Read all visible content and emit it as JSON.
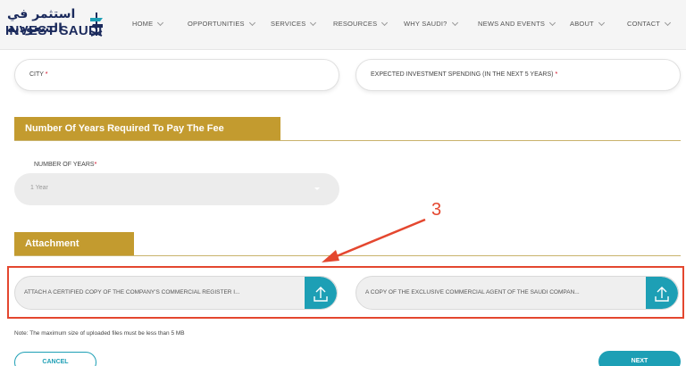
{
  "header": {
    "logo_arabic": "استثمر في السعودية",
    "logo_english": "INVEST SAUDI",
    "nav": [
      {
        "label": "HOME"
      },
      {
        "label": "OPPORTUNITIES"
      },
      {
        "label": "SERVICES"
      },
      {
        "label": "RESOURCES"
      },
      {
        "label": "WHY SAUDI?"
      },
      {
        "label": "NEWS AND EVENTS"
      },
      {
        "label": "ABOUT"
      },
      {
        "label": "CONTACT"
      }
    ]
  },
  "fields": {
    "city_label": "CITY",
    "spending_label": "EXPECTED INVESTMENT SPENDING (IN THE NEXT 5 YEARS)",
    "required_mark": "*"
  },
  "fee_section": {
    "title": "Number Of Years Required To Pay The Fee",
    "years_label": "NUMBER OF YEARS",
    "years_value": "1 Year"
  },
  "attachment_section": {
    "title": "Attachment",
    "upload_1": "ATTACH A CERTIFIED COPY OF THE COMPANY'S COMMERCIAL REGISTER I...",
    "upload_2": "A COPY OF THE EXCLUSIVE COMMERCIAL AGENT OF THE SAUDI COMPAN..."
  },
  "annotation": {
    "step_number": "3",
    "color": "#e4472f"
  },
  "note": "Note: The maximum size of uploaded files must be less than 5 MB",
  "actions": {
    "cancel": "CANCEL",
    "next": "NEXT"
  },
  "colors": {
    "gold": "#c39b2f",
    "teal": "#1d9fb5",
    "navy": "#1b2a5c"
  },
  "icons": [
    "chevron-down-icon",
    "upload-icon",
    "dropdown-caret-icon",
    "arrow-icon"
  ]
}
